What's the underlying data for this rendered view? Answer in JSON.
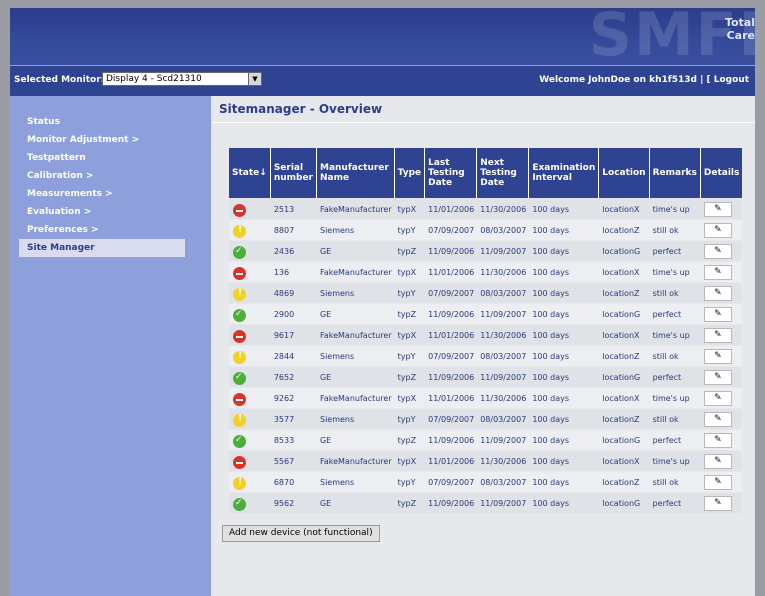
{
  "brand": "Total Care",
  "watermark": "SMFI",
  "topbar": {
    "monitor_label": "Selected Monitor:",
    "monitor_value": "Display 4 - Scd21310",
    "welcome": "Welcome JohnDoe on kh1f513d | [ Logout"
  },
  "sidebar": {
    "items": [
      {
        "label": "Status"
      },
      {
        "label": "Monitor Adjustment >"
      },
      {
        "label": "Testpattern"
      },
      {
        "label": "Calibration >"
      },
      {
        "label": "Measurements >"
      },
      {
        "label": "Evaluation >"
      },
      {
        "label": "Preferences >"
      },
      {
        "label": "Site Manager"
      }
    ]
  },
  "main": {
    "title": "Sitemanager - Overview",
    "add_button": "Add new device (not functional)"
  },
  "table": {
    "headers": [
      "State↓",
      "Serial number",
      "Manufacturer Name",
      "Type",
      "Last Testing Date",
      "Next Testing Date",
      "Examination Interval",
      "Location",
      "Remarks",
      "Details"
    ],
    "rows": [
      {
        "state": "red",
        "serial": "2513",
        "maker": "FakeManufacturer",
        "type": "typX",
        "last": "11/01/2006",
        "next": "11/30/2006",
        "interval": "100 days",
        "location": "locationX",
        "remarks": "time's up"
      },
      {
        "state": "yellow",
        "serial": "8807",
        "maker": "Siemens",
        "type": "typY",
        "last": "07/09/2007",
        "next": "08/03/2007",
        "interval": "100 days",
        "location": "locationZ",
        "remarks": "still ok"
      },
      {
        "state": "green",
        "serial": "2436",
        "maker": "GE",
        "type": "typZ",
        "last": "11/09/2006",
        "next": "11/09/2007",
        "interval": "100 days",
        "location": "locationG",
        "remarks": "perfect"
      },
      {
        "state": "red",
        "serial": "136",
        "maker": "FakeManufacturer",
        "type": "typX",
        "last": "11/01/2006",
        "next": "11/30/2006",
        "interval": "100 days",
        "location": "locationX",
        "remarks": "time's up"
      },
      {
        "state": "yellow",
        "serial": "4869",
        "maker": "Siemens",
        "type": "typY",
        "last": "07/09/2007",
        "next": "08/03/2007",
        "interval": "100 days",
        "location": "locationZ",
        "remarks": "still ok"
      },
      {
        "state": "green",
        "serial": "2900",
        "maker": "GE",
        "type": "typZ",
        "last": "11/09/2006",
        "next": "11/09/2007",
        "interval": "100 days",
        "location": "locationG",
        "remarks": "perfect"
      },
      {
        "state": "red",
        "serial": "9617",
        "maker": "FakeManufacturer",
        "type": "typX",
        "last": "11/01/2006",
        "next": "11/30/2006",
        "interval": "100 days",
        "location": "locationX",
        "remarks": "time's up"
      },
      {
        "state": "yellow",
        "serial": "2844",
        "maker": "Siemens",
        "type": "typY",
        "last": "07/09/2007",
        "next": "08/03/2007",
        "interval": "100 days",
        "location": "locationZ",
        "remarks": "still ok"
      },
      {
        "state": "green",
        "serial": "7652",
        "maker": "GE",
        "type": "typZ",
        "last": "11/09/2006",
        "next": "11/09/2007",
        "interval": "100 days",
        "location": "locationG",
        "remarks": "perfect"
      },
      {
        "state": "red",
        "serial": "9262",
        "maker": "FakeManufacturer",
        "type": "typX",
        "last": "11/01/2006",
        "next": "11/30/2006",
        "interval": "100 days",
        "location": "locationX",
        "remarks": "time's up"
      },
      {
        "state": "yellow",
        "serial": "3577",
        "maker": "Siemens",
        "type": "typY",
        "last": "07/09/2007",
        "next": "08/03/2007",
        "interval": "100 days",
        "location": "locationZ",
        "remarks": "still ok"
      },
      {
        "state": "green",
        "serial": "8533",
        "maker": "GE",
        "type": "typZ",
        "last": "11/09/2006",
        "next": "11/09/2007",
        "interval": "100 days",
        "location": "locationG",
        "remarks": "perfect"
      },
      {
        "state": "red",
        "serial": "5567",
        "maker": "FakeManufacturer",
        "type": "typX",
        "last": "11/01/2006",
        "next": "11/30/2006",
        "interval": "100 days",
        "location": "locationX",
        "remarks": "time's up"
      },
      {
        "state": "yellow",
        "serial": "6870",
        "maker": "Siemens",
        "type": "typY",
        "last": "07/09/2007",
        "next": "08/03/2007",
        "interval": "100 days",
        "location": "locationZ",
        "remarks": "still ok"
      },
      {
        "state": "green",
        "serial": "9562",
        "maker": "GE",
        "type": "typZ",
        "last": "11/09/2006",
        "next": "11/09/2007",
        "interval": "100 days",
        "location": "locationG",
        "remarks": "perfect"
      }
    ]
  }
}
